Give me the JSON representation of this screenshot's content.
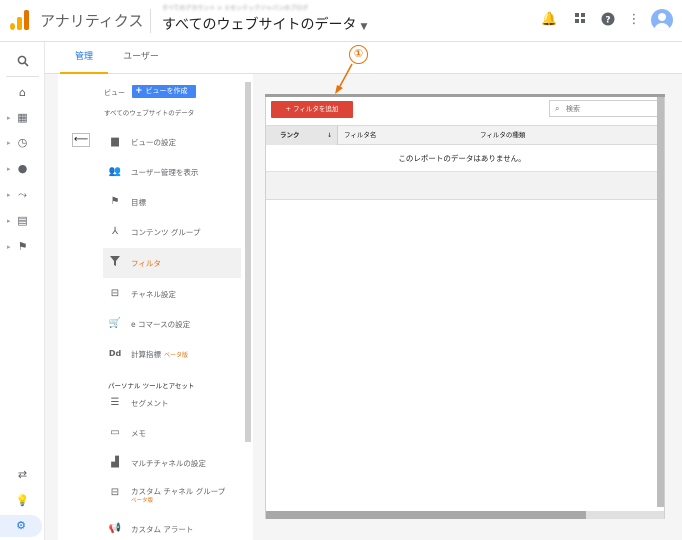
{
  "topbar": {
    "app_name": "アナリティクス",
    "account_path": "すべてのアカウント > ミセンテックジャパンのブログ",
    "account_title": "すべてのウェブサイトのデータ",
    "icons": [
      "bell-icon",
      "apps-grid-icon",
      "help-icon",
      "more-vert-icon",
      "account-avatar"
    ]
  },
  "rail": {
    "items": [
      "search-icon",
      "home-icon",
      "dashboard-icon",
      "realtime-icon",
      "audience-icon",
      "acquisition-icon",
      "behavior-icon",
      "conversions-icon"
    ],
    "bottom": [
      "attribution-icon",
      "discover-icon",
      "admin-gear-icon"
    ]
  },
  "tabs": {
    "admin": "管理",
    "user": "ユーザー"
  },
  "view": {
    "label": "ビュー",
    "create_button": "ビューを作成",
    "name": "すべてのウェブサイトのデータ"
  },
  "menu": {
    "items": [
      {
        "label": "ビューの設定",
        "icon": "document-icon"
      },
      {
        "label": "ユーザー管理を表示",
        "icon": "users-icon"
      },
      {
        "label": "目標",
        "icon": "flag-icon"
      },
      {
        "label": "コンテンツ グループ",
        "icon": "content-group-icon"
      },
      {
        "label": "フィルタ",
        "icon": "filter-icon"
      },
      {
        "label": "チャネル設定",
        "icon": "channel-icon"
      },
      {
        "label": "e コマースの設定",
        "icon": "cart-icon"
      },
      {
        "label": "計算指標",
        "icon": "dd-icon",
        "badge": "ベータ版"
      }
    ],
    "section_header": "パーソナル ツールとアセット",
    "personal_items": [
      {
        "label": "セグメント",
        "icon": "segment-icon"
      },
      {
        "label": "メモ",
        "icon": "memo-icon"
      },
      {
        "label": "マルチチャネルの設定",
        "icon": "bar-chart-icon"
      },
      {
        "label": "カスタム チャネル グループ",
        "icon": "custom-channel-icon",
        "badge": "ベータ版"
      },
      {
        "label": "カスタム アラート",
        "icon": "megaphone-icon"
      }
    ]
  },
  "filters": {
    "add_button": "+ フィルタを追加",
    "search_placeholder": "検索",
    "columns": {
      "rank": "ランク",
      "rank_sort": "↓",
      "name": "フィルタ名",
      "type": "フィルタの種類"
    },
    "empty_message": "このレポートのデータはありません。"
  },
  "annotation": {
    "marker": "①"
  },
  "colors": {
    "accent_blue": "#4285f4",
    "add_button_red": "#db4437",
    "active_orange": "#e8710a",
    "tab_underline": "#f9ab00"
  }
}
